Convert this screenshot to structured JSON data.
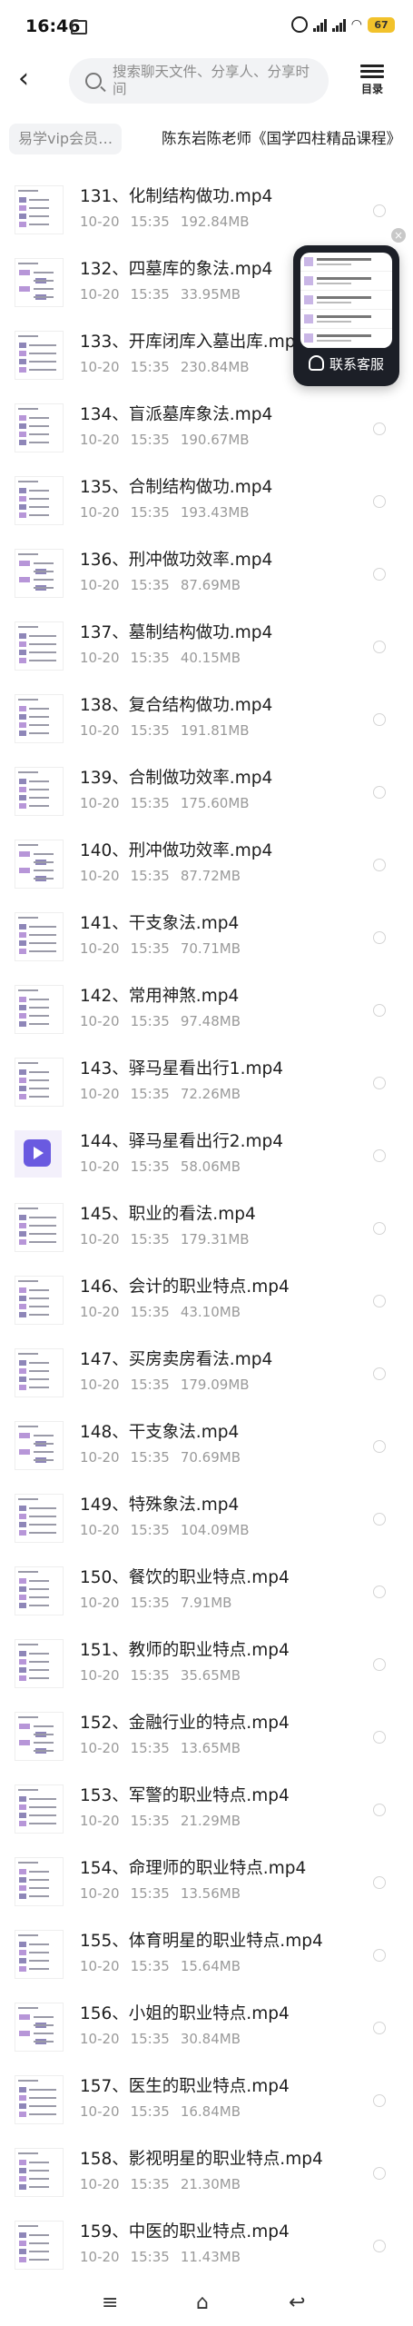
{
  "status": {
    "time": "16:46",
    "battery": "67",
    "network": "5G"
  },
  "header": {
    "search_placeholder": "搜索聊天文件、分享人、分享时间",
    "menu_label": "目录"
  },
  "breadcrumb": {
    "first": "易学vip会员…",
    "second": "陈东岩陈老师《国学四柱精品课程》"
  },
  "service": {
    "label": "联系客服"
  },
  "files": [
    {
      "name": "131、化制结构做功.mp4",
      "date": "10-20",
      "time": "15:35",
      "size": "192.84MB"
    },
    {
      "name": "132、四墓库的象法.mp4",
      "date": "10-20",
      "time": "15:35",
      "size": "33.95MB"
    },
    {
      "name": "133、开库闭库入墓出库.mp4",
      "date": "10-20",
      "time": "15:35",
      "size": "230.84MB"
    },
    {
      "name": "134、盲派墓库象法.mp4",
      "date": "10-20",
      "time": "15:35",
      "size": "190.67MB"
    },
    {
      "name": "135、合制结构做功.mp4",
      "date": "10-20",
      "time": "15:35",
      "size": "193.43MB"
    },
    {
      "name": "136、刑冲做功效率.mp4",
      "date": "10-20",
      "time": "15:35",
      "size": "87.69MB"
    },
    {
      "name": "137、墓制结构做功.mp4",
      "date": "10-20",
      "time": "15:35",
      "size": "40.15MB"
    },
    {
      "name": "138、复合结构做功.mp4",
      "date": "10-20",
      "time": "15:35",
      "size": "191.81MB"
    },
    {
      "name": "139、合制做功效率.mp4",
      "date": "10-20",
      "time": "15:35",
      "size": "175.60MB"
    },
    {
      "name": "140、刑冲做功效率.mp4",
      "date": "10-20",
      "time": "15:35",
      "size": "87.72MB"
    },
    {
      "name": "141、干支象法.mp4",
      "date": "10-20",
      "time": "15:35",
      "size": "70.71MB"
    },
    {
      "name": "142、常用神煞.mp4",
      "date": "10-20",
      "time": "15:35",
      "size": "97.48MB"
    },
    {
      "name": "143、驿马星看出行1.mp4",
      "date": "10-20",
      "time": "15:35",
      "size": "72.26MB"
    },
    {
      "name": "144、驿马星看出行2.mp4",
      "date": "10-20",
      "time": "15:35",
      "size": "58.06MB"
    },
    {
      "name": "145、职业的看法.mp4",
      "date": "10-20",
      "time": "15:35",
      "size": "179.31MB"
    },
    {
      "name": "146、会计的职业特点.mp4",
      "date": "10-20",
      "time": "15:35",
      "size": "43.10MB"
    },
    {
      "name": "147、买房卖房看法.mp4",
      "date": "10-20",
      "time": "15:35",
      "size": "179.09MB"
    },
    {
      "name": "148、干支象法.mp4",
      "date": "10-20",
      "time": "15:35",
      "size": "70.69MB"
    },
    {
      "name": "149、特殊象法.mp4",
      "date": "10-20",
      "time": "15:35",
      "size": "104.09MB"
    },
    {
      "name": "150、餐饮的职业特点.mp4",
      "date": "10-20",
      "time": "15:35",
      "size": "7.91MB"
    },
    {
      "name": "151、教师的职业特点.mp4",
      "date": "10-20",
      "time": "15:35",
      "size": "35.65MB"
    },
    {
      "name": "152、金融行业的特点.mp4",
      "date": "10-20",
      "time": "15:35",
      "size": "13.65MB"
    },
    {
      "name": "153、军警的职业特点.mp4",
      "date": "10-20",
      "time": "15:35",
      "size": "21.29MB"
    },
    {
      "name": "154、命理师的职业特点.mp4",
      "date": "10-20",
      "time": "15:35",
      "size": "13.56MB"
    },
    {
      "name": "155、体育明星的职业特点.mp4",
      "date": "10-20",
      "time": "15:35",
      "size": "15.64MB"
    },
    {
      "name": "156、小姐的职业特点.mp4",
      "date": "10-20",
      "time": "15:35",
      "size": "30.84MB"
    },
    {
      "name": "157、医生的职业特点.mp4",
      "date": "10-20",
      "time": "15:35",
      "size": "16.84MB"
    },
    {
      "name": "158、影视明星的职业特点.mp4",
      "date": "10-20",
      "time": "15:35",
      "size": "21.30MB"
    },
    {
      "name": "159、中医的职业特点.mp4",
      "date": "10-20",
      "time": "15:35",
      "size": "11.43MB"
    }
  ]
}
